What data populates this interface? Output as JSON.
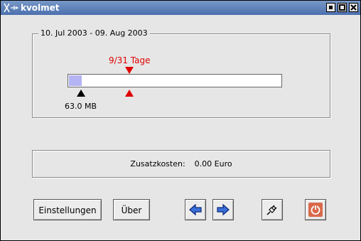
{
  "window": {
    "title": "kvolmet"
  },
  "titlebar_icons": [
    "x-logo-icon",
    "minimize-icon",
    "maximize-icon",
    "close-icon"
  ],
  "period": {
    "label": "10. Jul 2003 - 09. Aug 2003"
  },
  "progress": {
    "days_label": "9/31 Tage",
    "days_fraction": 0.29,
    "volume_label": "63.0 MB",
    "volume_fraction": 0.06,
    "fill_color": "#b4b4f2",
    "marker_color": "#e00000"
  },
  "costs": {
    "label": "Zusatzkosten:",
    "value": "0.00 Euro"
  },
  "buttons": {
    "settings": "Einstellungen",
    "about": "Über",
    "back_icon": "arrow-left-icon",
    "forward_icon": "arrow-right-icon",
    "connect_icon": "plug-icon",
    "power_icon": "power-icon"
  }
}
